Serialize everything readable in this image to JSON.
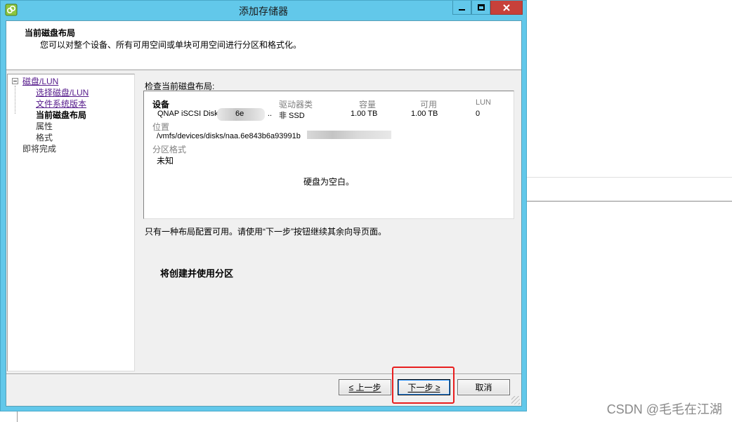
{
  "window": {
    "title": "添加存储器",
    "icon": "storage-wizard-icon",
    "colors": {
      "titlebar": "#62c8ea",
      "close": "#c7413a"
    }
  },
  "header": {
    "title": "当前磁盘布局",
    "description": "您可以对整个设备、所有可用空间或单块可用空间进行分区和格式化。"
  },
  "nav": {
    "root": "磁盘/LUN",
    "items": [
      {
        "label": "选择磁盘/LUN"
      },
      {
        "label": "文件系统版本"
      },
      {
        "label": "当前磁盘布局"
      },
      {
        "label": "属性"
      },
      {
        "label": "格式"
      }
    ],
    "finish": "即将完成"
  },
  "main": {
    "section_label": "检查当前磁盘布局:",
    "table": {
      "columns": [
        "设备",
        "驱动器类",
        "容量",
        "可用",
        "LUN"
      ],
      "row": {
        "device": "QNAP iSCSI Disk (",
        "device_tail": "6e",
        "device_ellipsis": "..",
        "drive_type": "非 SSD",
        "capacity": "1.00 TB",
        "available": "1.00 TB",
        "lun": "0"
      }
    },
    "location_label": "位置",
    "location_value": "/vmfs/devices/disks/naa.6e843b6a93991b",
    "partition_format_label": "分区格式",
    "partition_format_value": "未知",
    "empty_message": "硬盘为空白。",
    "note": "只有一种布局配置可用。请使用“下一步”按钮继续其余向导页面。",
    "create_note": "将创建并使用分区"
  },
  "buttons": {
    "back": "≤ 上一步",
    "next": "下一步 ≥",
    "cancel": "取消"
  },
  "watermark": "CSDN @毛毛在江湖"
}
